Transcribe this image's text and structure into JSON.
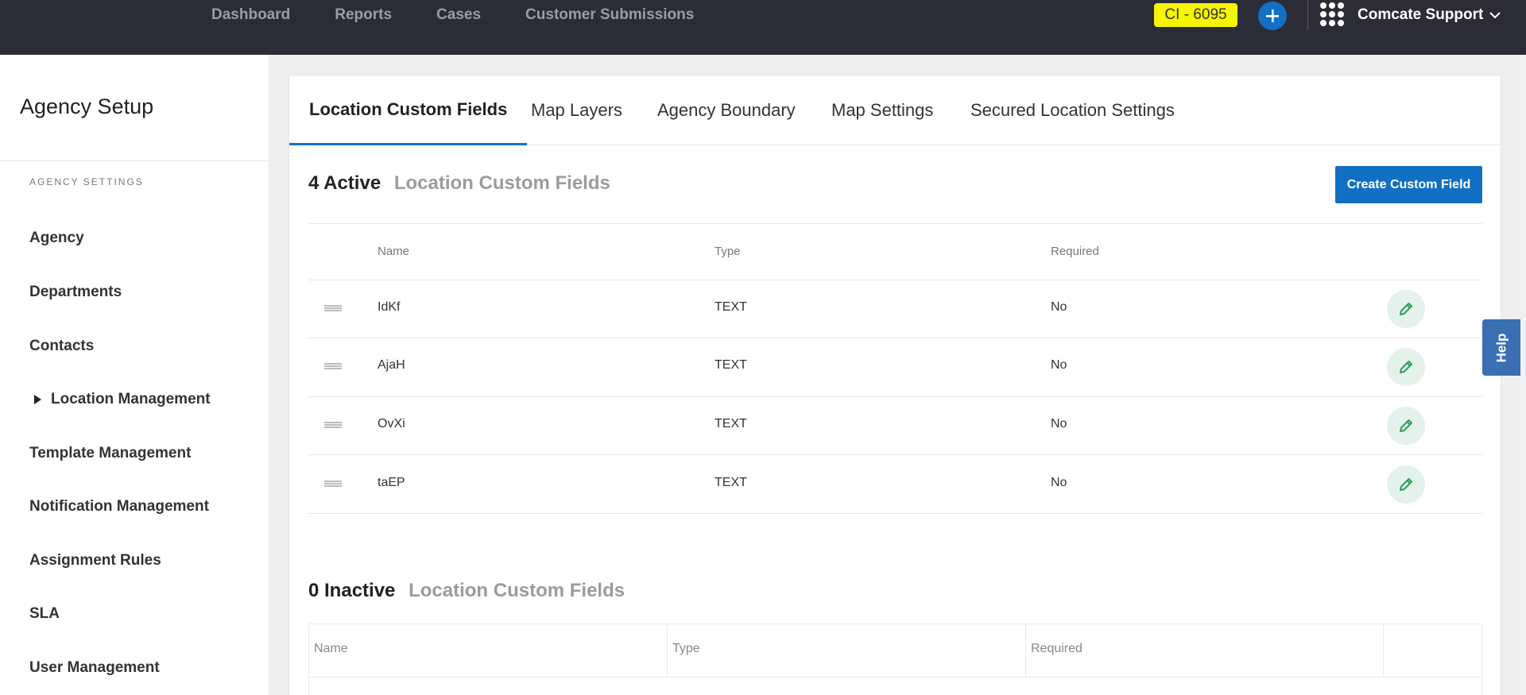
{
  "topbar": {
    "nav": [
      "Dashboard",
      "Reports",
      "Cases",
      "Customer Submissions"
    ],
    "ci_badge": "CI - 6095",
    "account_name": "Comcate Support",
    "icons": {
      "add": "plus-icon",
      "apps": "grid-icon",
      "dropdown": "chevron-down-icon"
    },
    "colors": {
      "bar": "#2c2c37",
      "badge": "#f7f500",
      "accent": "#1170c4"
    }
  },
  "sidebar": {
    "title": "Agency Setup",
    "section": "AGENCY SETTINGS",
    "items": [
      {
        "label": "Agency"
      },
      {
        "label": "Departments"
      },
      {
        "label": "Contacts"
      },
      {
        "label": "Location Management",
        "expandable": true
      },
      {
        "label": "Template Management"
      },
      {
        "label": "Notification Management"
      },
      {
        "label": "Assignment Rules"
      },
      {
        "label": "SLA"
      },
      {
        "label": "User Management"
      }
    ]
  },
  "tabs": [
    {
      "label": "Location Custom Fields",
      "active": true
    },
    {
      "label": "Map Layers"
    },
    {
      "label": "Agency Boundary"
    },
    {
      "label": "Map Settings"
    },
    {
      "label": "Secured Location Settings"
    }
  ],
  "active_section": {
    "count": "4 Active",
    "label": "Location Custom Fields",
    "create_button": "Create Custom Field",
    "columns": [
      "Name",
      "Type",
      "Required"
    ],
    "rows": [
      {
        "name": "IdKf",
        "type": "TEXT",
        "required": "No"
      },
      {
        "name": "AjaH",
        "type": "TEXT",
        "required": "No"
      },
      {
        "name": "OvXi",
        "type": "TEXT",
        "required": "No"
      },
      {
        "name": "taEP",
        "type": "TEXT",
        "required": "No"
      }
    ]
  },
  "inactive_section": {
    "count": "0 Inactive",
    "label": "Location Custom Fields",
    "columns": [
      "Name",
      "Type",
      "Required"
    ]
  },
  "help_tab": "Help"
}
